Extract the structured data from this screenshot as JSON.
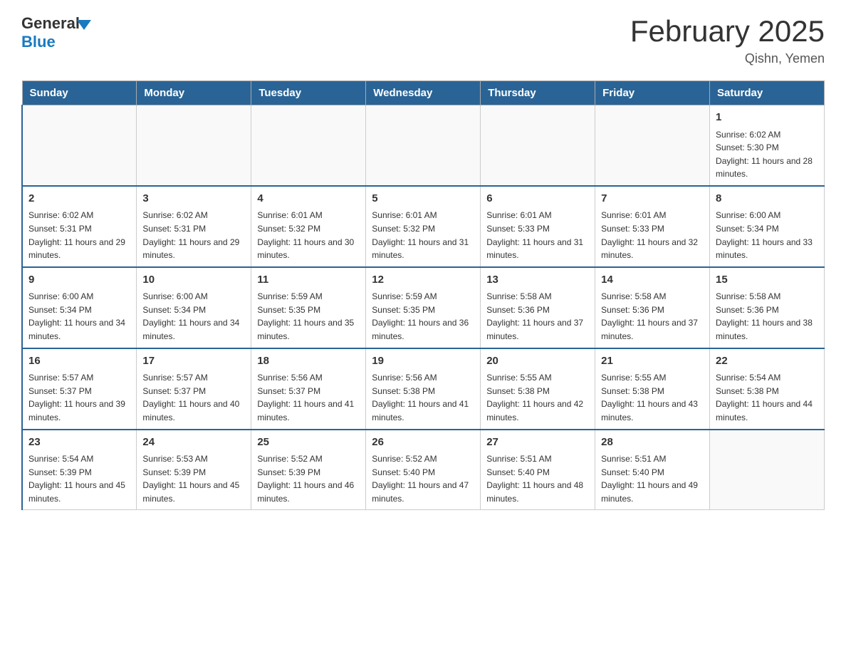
{
  "header": {
    "logo_general": "General",
    "logo_blue": "Blue",
    "month_title": "February 2025",
    "location": "Qishn, Yemen"
  },
  "days_of_week": [
    "Sunday",
    "Monday",
    "Tuesday",
    "Wednesday",
    "Thursday",
    "Friday",
    "Saturday"
  ],
  "weeks": [
    {
      "days": [
        {
          "date": "",
          "info": ""
        },
        {
          "date": "",
          "info": ""
        },
        {
          "date": "",
          "info": ""
        },
        {
          "date": "",
          "info": ""
        },
        {
          "date": "",
          "info": ""
        },
        {
          "date": "",
          "info": ""
        },
        {
          "date": "1",
          "info": "Sunrise: 6:02 AM\nSunset: 5:30 PM\nDaylight: 11 hours and 28 minutes."
        }
      ]
    },
    {
      "days": [
        {
          "date": "2",
          "info": "Sunrise: 6:02 AM\nSunset: 5:31 PM\nDaylight: 11 hours and 29 minutes."
        },
        {
          "date": "3",
          "info": "Sunrise: 6:02 AM\nSunset: 5:31 PM\nDaylight: 11 hours and 29 minutes."
        },
        {
          "date": "4",
          "info": "Sunrise: 6:01 AM\nSunset: 5:32 PM\nDaylight: 11 hours and 30 minutes."
        },
        {
          "date": "5",
          "info": "Sunrise: 6:01 AM\nSunset: 5:32 PM\nDaylight: 11 hours and 31 minutes."
        },
        {
          "date": "6",
          "info": "Sunrise: 6:01 AM\nSunset: 5:33 PM\nDaylight: 11 hours and 31 minutes."
        },
        {
          "date": "7",
          "info": "Sunrise: 6:01 AM\nSunset: 5:33 PM\nDaylight: 11 hours and 32 minutes."
        },
        {
          "date": "8",
          "info": "Sunrise: 6:00 AM\nSunset: 5:34 PM\nDaylight: 11 hours and 33 minutes."
        }
      ]
    },
    {
      "days": [
        {
          "date": "9",
          "info": "Sunrise: 6:00 AM\nSunset: 5:34 PM\nDaylight: 11 hours and 34 minutes."
        },
        {
          "date": "10",
          "info": "Sunrise: 6:00 AM\nSunset: 5:34 PM\nDaylight: 11 hours and 34 minutes."
        },
        {
          "date": "11",
          "info": "Sunrise: 5:59 AM\nSunset: 5:35 PM\nDaylight: 11 hours and 35 minutes."
        },
        {
          "date": "12",
          "info": "Sunrise: 5:59 AM\nSunset: 5:35 PM\nDaylight: 11 hours and 36 minutes."
        },
        {
          "date": "13",
          "info": "Sunrise: 5:58 AM\nSunset: 5:36 PM\nDaylight: 11 hours and 37 minutes."
        },
        {
          "date": "14",
          "info": "Sunrise: 5:58 AM\nSunset: 5:36 PM\nDaylight: 11 hours and 37 minutes."
        },
        {
          "date": "15",
          "info": "Sunrise: 5:58 AM\nSunset: 5:36 PM\nDaylight: 11 hours and 38 minutes."
        }
      ]
    },
    {
      "days": [
        {
          "date": "16",
          "info": "Sunrise: 5:57 AM\nSunset: 5:37 PM\nDaylight: 11 hours and 39 minutes."
        },
        {
          "date": "17",
          "info": "Sunrise: 5:57 AM\nSunset: 5:37 PM\nDaylight: 11 hours and 40 minutes."
        },
        {
          "date": "18",
          "info": "Sunrise: 5:56 AM\nSunset: 5:37 PM\nDaylight: 11 hours and 41 minutes."
        },
        {
          "date": "19",
          "info": "Sunrise: 5:56 AM\nSunset: 5:38 PM\nDaylight: 11 hours and 41 minutes."
        },
        {
          "date": "20",
          "info": "Sunrise: 5:55 AM\nSunset: 5:38 PM\nDaylight: 11 hours and 42 minutes."
        },
        {
          "date": "21",
          "info": "Sunrise: 5:55 AM\nSunset: 5:38 PM\nDaylight: 11 hours and 43 minutes."
        },
        {
          "date": "22",
          "info": "Sunrise: 5:54 AM\nSunset: 5:38 PM\nDaylight: 11 hours and 44 minutes."
        }
      ]
    },
    {
      "days": [
        {
          "date": "23",
          "info": "Sunrise: 5:54 AM\nSunset: 5:39 PM\nDaylight: 11 hours and 45 minutes."
        },
        {
          "date": "24",
          "info": "Sunrise: 5:53 AM\nSunset: 5:39 PM\nDaylight: 11 hours and 45 minutes."
        },
        {
          "date": "25",
          "info": "Sunrise: 5:52 AM\nSunset: 5:39 PM\nDaylight: 11 hours and 46 minutes."
        },
        {
          "date": "26",
          "info": "Sunrise: 5:52 AM\nSunset: 5:40 PM\nDaylight: 11 hours and 47 minutes."
        },
        {
          "date": "27",
          "info": "Sunrise: 5:51 AM\nSunset: 5:40 PM\nDaylight: 11 hours and 48 minutes."
        },
        {
          "date": "28",
          "info": "Sunrise: 5:51 AM\nSunset: 5:40 PM\nDaylight: 11 hours and 49 minutes."
        },
        {
          "date": "",
          "info": ""
        }
      ]
    }
  ]
}
